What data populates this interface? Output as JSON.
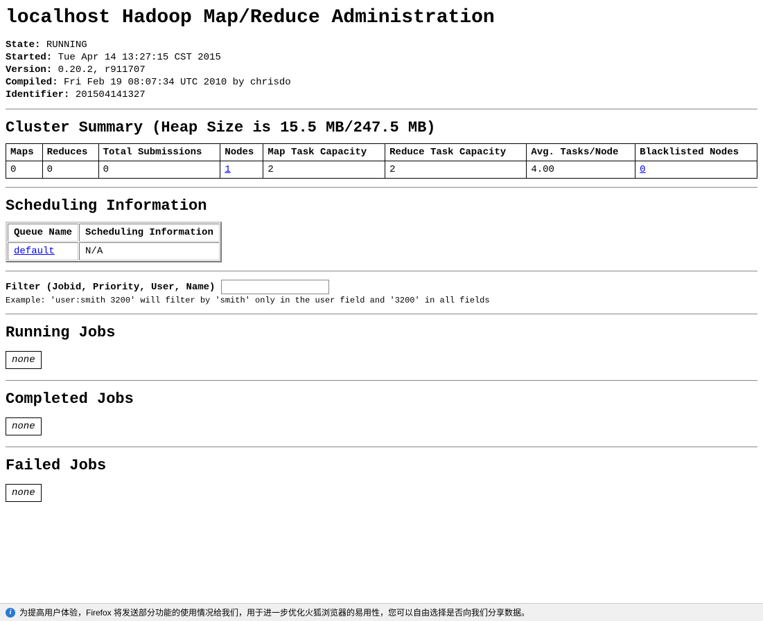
{
  "title": "localhost Hadoop Map/Reduce Administration",
  "info": {
    "state_label": "State:",
    "state_value": "RUNNING",
    "started_label": "Started:",
    "started_value": "Tue Apr 14 13:27:15 CST 2015",
    "version_label": "Version:",
    "version_value": "0.20.2, r911707",
    "compiled_label": "Compiled:",
    "compiled_value": "Fri Feb 19 08:07:34 UTC 2010 by chrisdo",
    "identifier_label": "Identifier:",
    "identifier_value": "201504141327"
  },
  "cluster": {
    "heading": "Cluster Summary (Heap Size is 15.5 MB/247.5 MB)",
    "headers": {
      "maps": "Maps",
      "reduces": "Reduces",
      "total_submissions": "Total Submissions",
      "nodes": "Nodes",
      "map_task_capacity": "Map Task Capacity",
      "reduce_task_capacity": "Reduce Task Capacity",
      "avg_tasks_node": "Avg. Tasks/Node",
      "blacklisted_nodes": "Blacklisted Nodes"
    },
    "row": {
      "maps": "0",
      "reduces": "0",
      "total_submissions": "0",
      "nodes": "1",
      "map_task_capacity": "2",
      "reduce_task_capacity": "2",
      "avg_tasks_node": "4.00",
      "blacklisted_nodes": "0"
    }
  },
  "scheduling": {
    "heading": "Scheduling Information",
    "headers": {
      "queue_name": "Queue Name",
      "scheduling_info": "Scheduling Information"
    },
    "row": {
      "queue_name": "default",
      "scheduling_info": "N/A"
    }
  },
  "filter": {
    "label": "Filter (Jobid, Priority, User, Name)",
    "value": "",
    "example": "Example: 'user:smith 3200' will filter by 'smith' only in the user field and '3200' in all fields"
  },
  "sections": {
    "running": "Running Jobs",
    "completed": "Completed Jobs",
    "failed": "Failed Jobs",
    "none": "none"
  },
  "notification": {
    "text": "为提高用户体验，Firefox 将发送部分功能的使用情况给我们，用于进一步优化火狐浏览器的易用性，您可以自由选择是否向我们分享数据。"
  }
}
